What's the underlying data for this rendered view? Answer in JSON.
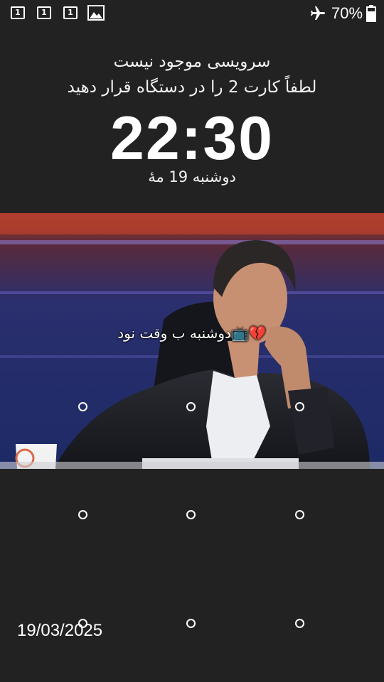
{
  "status_bar": {
    "notifications": [
      "1",
      "1",
      "1"
    ],
    "notification_icon_names": [
      "sim-1-icon",
      "sim-1-icon",
      "sim-1-icon",
      "image-icon"
    ],
    "airplane_mode": true,
    "battery_text": "70%",
    "battery_level": 0.7
  },
  "lock_screen": {
    "carrier_line_1": "سرویسی موجود نیست",
    "carrier_line_2": "لطفاً کارت 2 را در دستگاه قرار دهید",
    "time": "22:30",
    "date": "دوشنبه 19 مهٔ",
    "caption_text": "دوشنبه ب وقت نود",
    "caption_emoji": "📺💔",
    "bottom_date": "19/03/2025"
  },
  "pattern": {
    "rows": 3,
    "cols": 3
  },
  "colors": {
    "background": "#232222",
    "text": "#ffffff"
  }
}
